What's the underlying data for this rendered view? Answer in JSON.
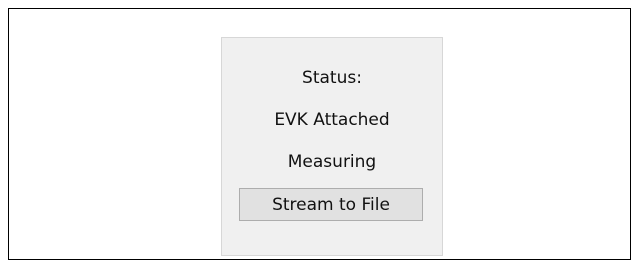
{
  "status_panel": {
    "title": "Status:",
    "connection": "EVK Attached",
    "activity": "Measuring",
    "stream_button_label": "Stream to File"
  }
}
